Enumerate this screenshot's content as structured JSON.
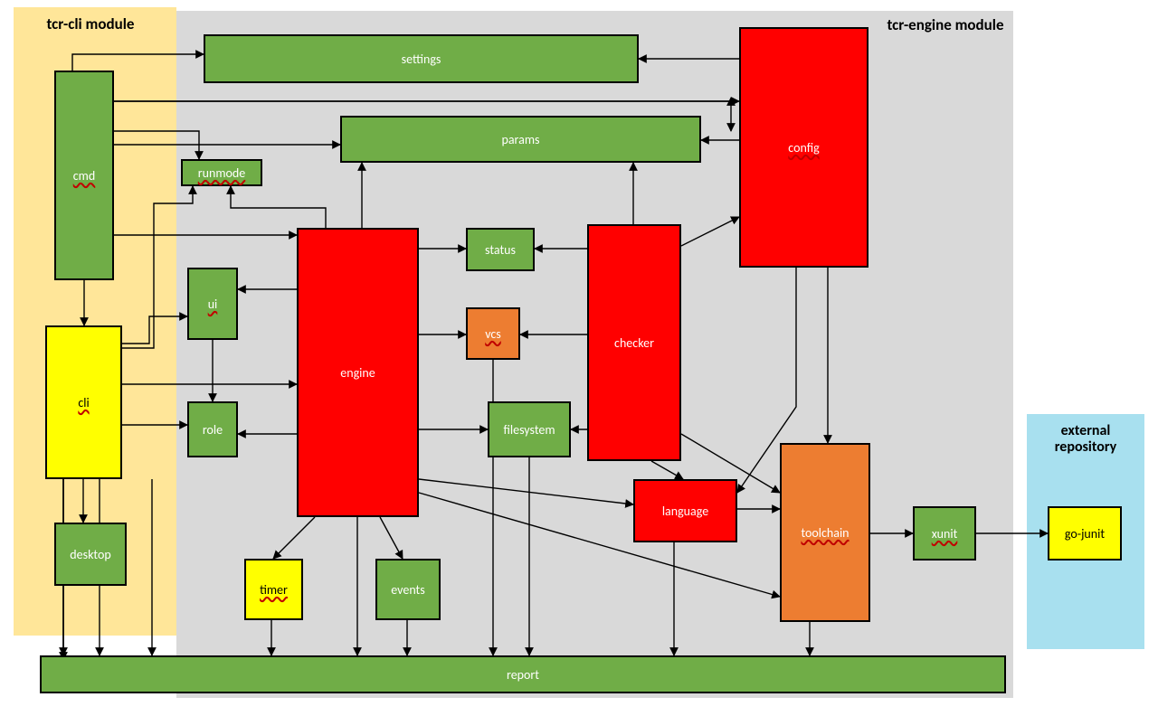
{
  "regions": {
    "cli": {
      "label": "tcr-cli module",
      "bg": "#ffe699"
    },
    "engine": {
      "label": "tcr-engine module",
      "bg": "#d9d9d9"
    },
    "ext": {
      "label": "external repository",
      "bg": "#a8e0ef"
    }
  },
  "boxes": {
    "cmd": {
      "label": "cmd",
      "color": "green"
    },
    "cli": {
      "label": "cli",
      "color": "yellow"
    },
    "desktop": {
      "label": "desktop",
      "color": "green"
    },
    "settings": {
      "label": "settings",
      "color": "green"
    },
    "runmode": {
      "label": "runmode",
      "color": "green"
    },
    "params": {
      "label": "params",
      "color": "green"
    },
    "ui": {
      "label": "ui",
      "color": "green"
    },
    "role": {
      "label": "role",
      "color": "green"
    },
    "engine": {
      "label": "engine",
      "color": "red"
    },
    "timer": {
      "label": "timer",
      "color": "yellow"
    },
    "events": {
      "label": "events",
      "color": "green"
    },
    "status": {
      "label": "status",
      "color": "green"
    },
    "vcs": {
      "label": "vcs",
      "color": "orange"
    },
    "filesystem": {
      "label": "filesystem",
      "color": "green"
    },
    "checker": {
      "label": "checker",
      "color": "red"
    },
    "language": {
      "label": "language",
      "color": "red"
    },
    "config": {
      "label": "config",
      "color": "red"
    },
    "toolchain": {
      "label": "toolchain",
      "color": "orange"
    },
    "xunit": {
      "label": "xunit",
      "color": "green"
    },
    "gojunit": {
      "label": "go-junit",
      "color": "yellow"
    },
    "report": {
      "label": "report",
      "color": "green"
    }
  },
  "edges": [
    [
      "cmd",
      "cli"
    ],
    [
      "cmd",
      "settings"
    ],
    [
      "cmd",
      "params"
    ],
    [
      "cmd",
      "runmode"
    ],
    [
      "cmd",
      "engine"
    ],
    [
      "cmd",
      "config"
    ],
    [
      "cli",
      "desktop"
    ],
    [
      "cli",
      "ui"
    ],
    [
      "cli",
      "role"
    ],
    [
      "cli",
      "engine"
    ],
    [
      "cli",
      "runmode"
    ],
    [
      "cli",
      "report"
    ],
    [
      "engine",
      "runmode"
    ],
    [
      "engine",
      "params"
    ],
    [
      "engine",
      "status"
    ],
    [
      "engine",
      "vcs"
    ],
    [
      "engine",
      "filesystem"
    ],
    [
      "engine",
      "ui"
    ],
    [
      "engine",
      "role"
    ],
    [
      "engine",
      "checker"
    ],
    [
      "engine",
      "language"
    ],
    [
      "engine",
      "toolchain"
    ],
    [
      "engine",
      "timer"
    ],
    [
      "engine",
      "events"
    ],
    [
      "engine",
      "report"
    ],
    [
      "ui",
      "role"
    ],
    [
      "checker",
      "params"
    ],
    [
      "checker",
      "status"
    ],
    [
      "checker",
      "vcs"
    ],
    [
      "checker",
      "filesystem"
    ],
    [
      "checker",
      "language"
    ],
    [
      "checker",
      "toolchain"
    ],
    [
      "checker",
      "config"
    ],
    [
      "config",
      "settings"
    ],
    [
      "config",
      "params"
    ],
    [
      "config",
      "language"
    ],
    [
      "config",
      "toolchain"
    ],
    [
      "language",
      "toolchain"
    ],
    [
      "toolchain",
      "xunit"
    ],
    [
      "xunit",
      "gojunit"
    ],
    [
      "timer",
      "report"
    ],
    [
      "events",
      "report"
    ],
    [
      "vcs",
      "report"
    ],
    [
      "filesystem",
      "report"
    ],
    [
      "language",
      "report"
    ],
    [
      "toolchain",
      "report"
    ]
  ]
}
